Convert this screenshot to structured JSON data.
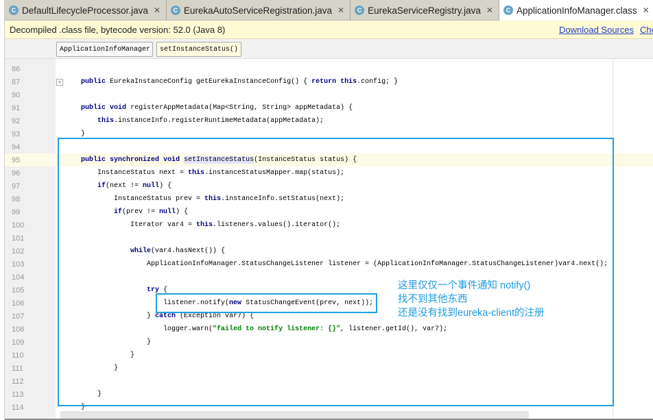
{
  "tabs": [
    {
      "label": "DefaultLifecycleProcessor.java",
      "active": false
    },
    {
      "label": "EurekaAutoServiceRegistration.java",
      "active": false
    },
    {
      "label": "EurekaServiceRegistry.java",
      "active": false
    },
    {
      "label": "ApplicationInfoManager.class",
      "active": true
    }
  ],
  "banner": {
    "text": "Decompiled .class file, bytecode version: 52.0 (Java 8)",
    "download_sources": "Download Sources",
    "choose_sources": "Cho"
  },
  "breadcrumb": [
    "ApplicationInfoManager",
    "setInstanceStatus()"
  ],
  "accent": "#1ea0e0",
  "code": [
    {
      "n": "86",
      "tokens": []
    },
    {
      "n": "87",
      "fold": "+",
      "tokens": [
        [
          "    ",
          ""
        ],
        [
          "public",
          "kw"
        ],
        [
          " EurekaInstanceConfig getEurekaInstanceConfig() { ",
          ""
        ],
        [
          "return",
          "kw"
        ],
        [
          " ",
          ""
        ],
        [
          "this",
          "kw"
        ],
        [
          ".config; }",
          ""
        ]
      ]
    },
    {
      "n": "90",
      "tokens": []
    },
    {
      "n": "91",
      "tokens": [
        [
          "    ",
          ""
        ],
        [
          "public",
          "kw"
        ],
        [
          " ",
          ""
        ],
        [
          "void",
          "kw"
        ],
        [
          " registerAppMetadata(Map<String, String> appMetadata) {",
          ""
        ]
      ]
    },
    {
      "n": "92",
      "tokens": [
        [
          "        ",
          ""
        ],
        [
          "this",
          "kw"
        ],
        [
          ".instanceInfo.registerRuntimeMetadata(appMetadata);",
          ""
        ]
      ]
    },
    {
      "n": "93",
      "tokens": [
        [
          "    }",
          ""
        ]
      ]
    },
    {
      "n": "94",
      "tokens": []
    },
    {
      "n": "95",
      "current": true,
      "tokens": [
        [
          "    ",
          ""
        ],
        [
          "public",
          "kw"
        ],
        [
          " ",
          ""
        ],
        [
          "synchronized",
          "kw"
        ],
        [
          " ",
          ""
        ],
        [
          "void",
          "kw"
        ],
        [
          " ",
          ""
        ],
        [
          "setInstanceStatus",
          "hl"
        ],
        [
          "(InstanceStatus status) {",
          ""
        ]
      ]
    },
    {
      "n": "96",
      "tokens": [
        [
          "        InstanceStatus next = ",
          ""
        ],
        [
          "this",
          "kw"
        ],
        [
          ".instanceStatusMapper.map(status);",
          ""
        ]
      ]
    },
    {
      "n": "97",
      "tokens": [
        [
          "        ",
          ""
        ],
        [
          "if",
          "kw"
        ],
        [
          "(next != ",
          ""
        ],
        [
          "null",
          "kw"
        ],
        [
          ") {",
          ""
        ]
      ]
    },
    {
      "n": "98",
      "tokens": [
        [
          "            InstanceStatus prev = ",
          ""
        ],
        [
          "this",
          "kw"
        ],
        [
          ".instanceInfo.setStatus(next);",
          ""
        ]
      ]
    },
    {
      "n": "99",
      "tokens": [
        [
          "            ",
          ""
        ],
        [
          "if",
          "kw"
        ],
        [
          "(prev != ",
          ""
        ],
        [
          "null",
          "kw"
        ],
        [
          ") {",
          ""
        ]
      ]
    },
    {
      "n": "100",
      "tokens": [
        [
          "                Iterator var4 = ",
          ""
        ],
        [
          "this",
          "kw"
        ],
        [
          ".listeners.values().iterator();",
          ""
        ]
      ]
    },
    {
      "n": "101",
      "tokens": []
    },
    {
      "n": "102",
      "tokens": [
        [
          "                ",
          ""
        ],
        [
          "while",
          "kw"
        ],
        [
          "(var4.hasNext()) {",
          ""
        ]
      ]
    },
    {
      "n": "103",
      "tokens": [
        [
          "                    ApplicationInfoManager.StatusChangeListener listener = (ApplicationInfoManager.StatusChangeListener)var4.next();",
          ""
        ]
      ]
    },
    {
      "n": "104",
      "tokens": []
    },
    {
      "n": "105",
      "tokens": [
        [
          "                    ",
          ""
        ],
        [
          "try",
          "kw"
        ],
        [
          " {",
          ""
        ]
      ]
    },
    {
      "n": "106",
      "tokens": [
        [
          "                        listener.notify(",
          ""
        ],
        [
          "new",
          "kw"
        ],
        [
          " StatusChangeEvent(prev, next));",
          ""
        ]
      ]
    },
    {
      "n": "107",
      "tokens": [
        [
          "                    } ",
          ""
        ],
        [
          "catch",
          "kw"
        ],
        [
          " (Exception var7) {",
          ""
        ]
      ]
    },
    {
      "n": "108",
      "tokens": [
        [
          "                        logger.warn(",
          ""
        ],
        [
          "\"failed to notify listener: {}\"",
          "str"
        ],
        [
          ", listener.getId(), var7);",
          ""
        ]
      ]
    },
    {
      "n": "109",
      "tokens": [
        [
          "                    }",
          ""
        ]
      ]
    },
    {
      "n": "110",
      "tokens": [
        [
          "                }",
          ""
        ]
      ]
    },
    {
      "n": "111",
      "tokens": [
        [
          "            }",
          ""
        ]
      ]
    },
    {
      "n": "112",
      "tokens": []
    },
    {
      "n": "113",
      "tokens": [
        [
          "        }",
          ""
        ]
      ]
    },
    {
      "n": "114",
      "tokens": [
        [
          "    }",
          ""
        ]
      ]
    }
  ],
  "annotation": [
    "这里仅仅一个事件通知 notify()",
    "找不到其他东西",
    "还是没有找到eureka-client的注册"
  ]
}
